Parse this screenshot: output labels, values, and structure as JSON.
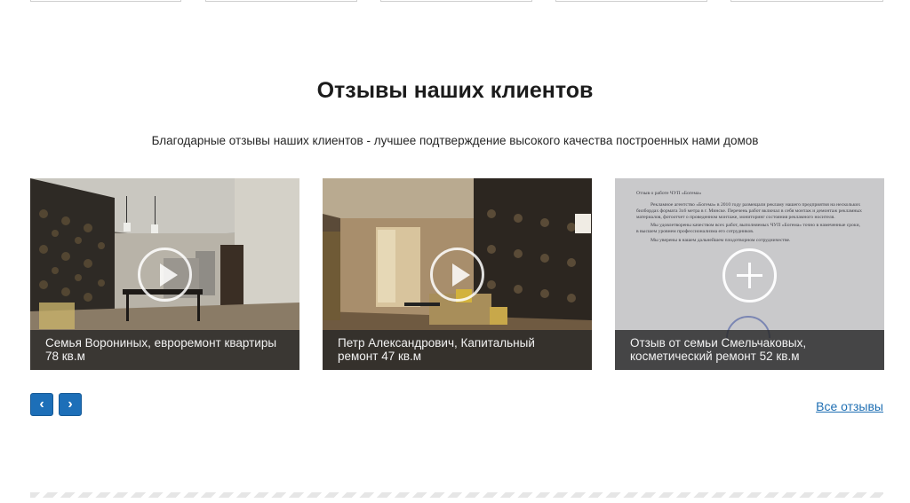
{
  "section": {
    "title": "Отзывы наших клиентов",
    "subtitle": "Благодарные отзывы наших клиентов - лучшее подтверждение высокого качества построенных нами домов"
  },
  "cards": [
    {
      "caption_line1": "Семья Ворониных, евроремонт квартиры",
      "caption_line2": "78 кв.м",
      "media": "video"
    },
    {
      "caption_line1": "Петр Александрович, Капитальный",
      "caption_line2": "ремонт 47 кв.м",
      "media": "video"
    },
    {
      "caption_line1": "Отзыв от семьи Смельчаковых,",
      "caption_line2": "косметический ремонт 52 кв.м",
      "media": "document"
    }
  ],
  "letter": {
    "heading": "Отзыв о работе ЧУП «Богема»",
    "p1": "Рекламное агентство «Богема» в 2010 году размещали рекламу нашего предприятия на нескольких билбордах формата 3х6 метра в г. Минске. Перечень работ включал в себя монтаж и демонтаж рекламных материалов, фотоотчет о проведенном монтаже, мониторинг состояния рекламного носителя.",
    "p2": "Мы удовлетворены качеством всех работ, выполняемых ЧУП «Богема» точно в намеченные сроки, в высшем уровнем профессионализма его сотрудников.",
    "p3": "Мы уверены в нашем дальнейшем плодотворном сотрудничестве."
  },
  "navigation": {
    "prev_label": "‹",
    "next_label": "›",
    "all_reviews_label": "Все отзывы"
  },
  "colors": {
    "accent": "#1d6fb8",
    "link": "#1f6fb3",
    "caption_bg": "#282828"
  }
}
